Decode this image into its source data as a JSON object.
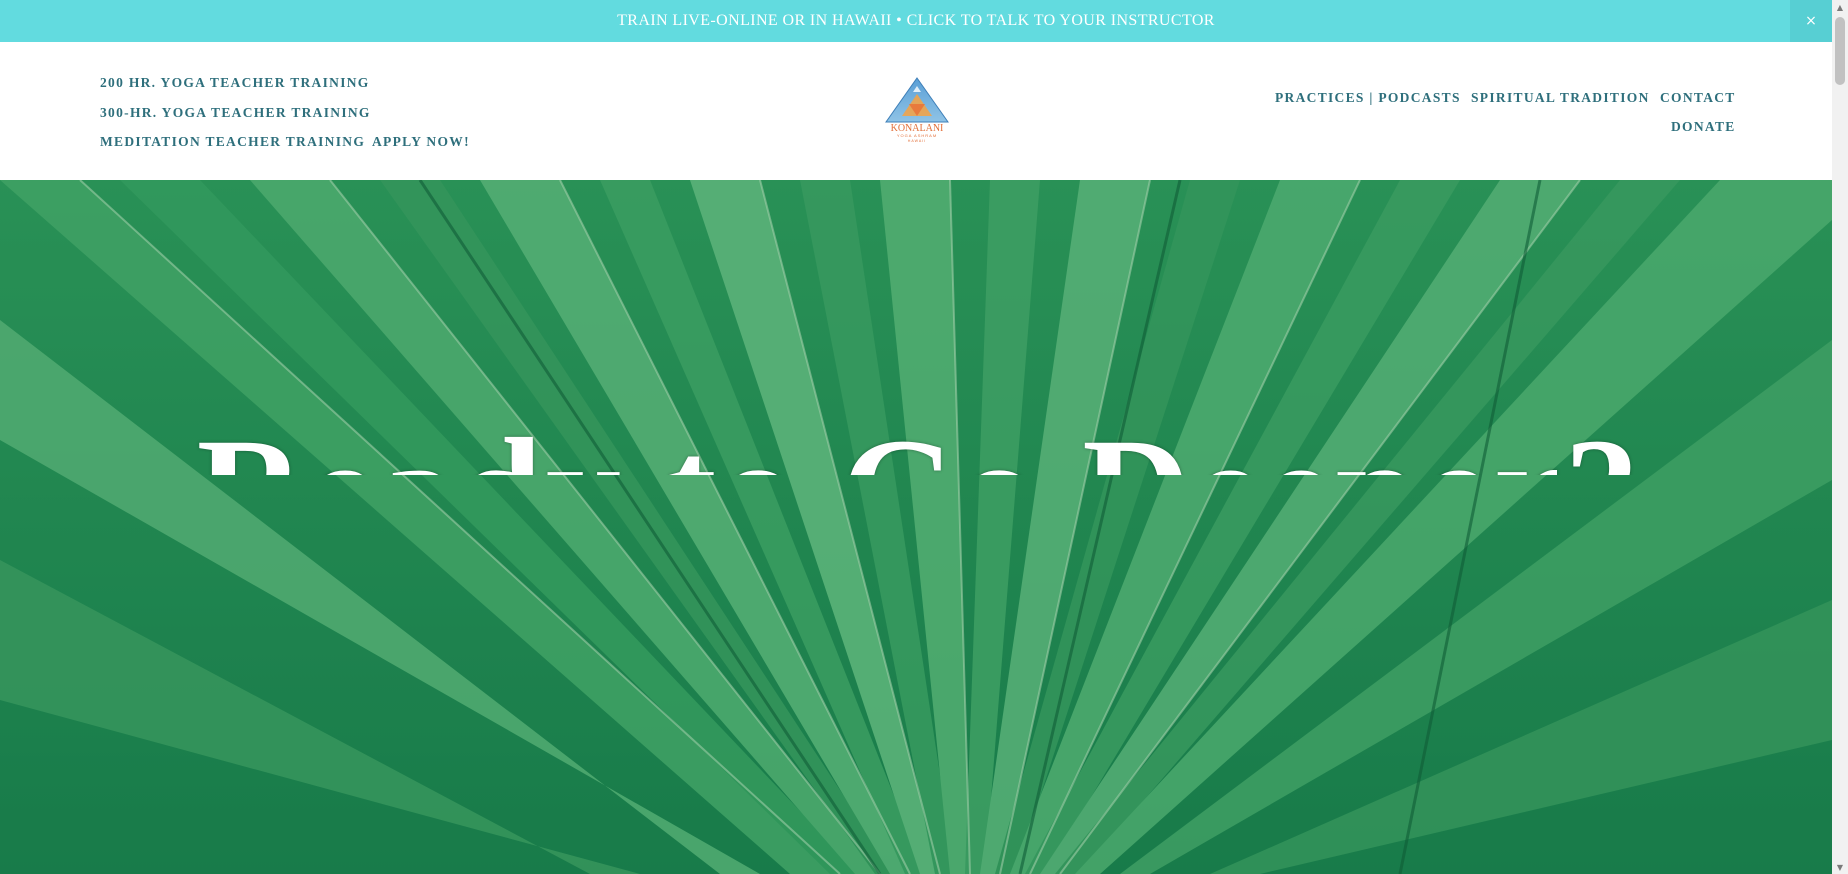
{
  "announcement": {
    "text": "TRAIN LIVE-ONLINE OR IN HAWAII • CLICK TO TALK TO YOUR INSTRUCTOR",
    "close_label": "×",
    "background": "#62dbdf"
  },
  "logo": {
    "name": "KONALANI",
    "subtitle": "YOGA ASHRAM",
    "location": "HAWAII"
  },
  "nav_left": [
    {
      "label": "200 HR. YOGA TEACHER TRAINING"
    },
    {
      "label": "300-HR. YOGA TEACHER TRAINING"
    },
    {
      "label": "MEDITATION TEACHER TRAINING"
    },
    {
      "label": "APPLY NOW!"
    }
  ],
  "nav_right": [
    {
      "label": "PRACTICES | PODCASTS"
    },
    {
      "label": "SPIRITUAL TRADITION"
    },
    {
      "label": "CONTACT"
    },
    {
      "label": "DONATE"
    }
  ],
  "hero": {
    "title": "Ready to Go Deeper?"
  },
  "colors": {
    "nav_text": "#2e6f7c",
    "hero_green": "#1f8a55"
  },
  "scrollbar": {
    "up_arrow": "▲",
    "down_arrow": "▼"
  }
}
